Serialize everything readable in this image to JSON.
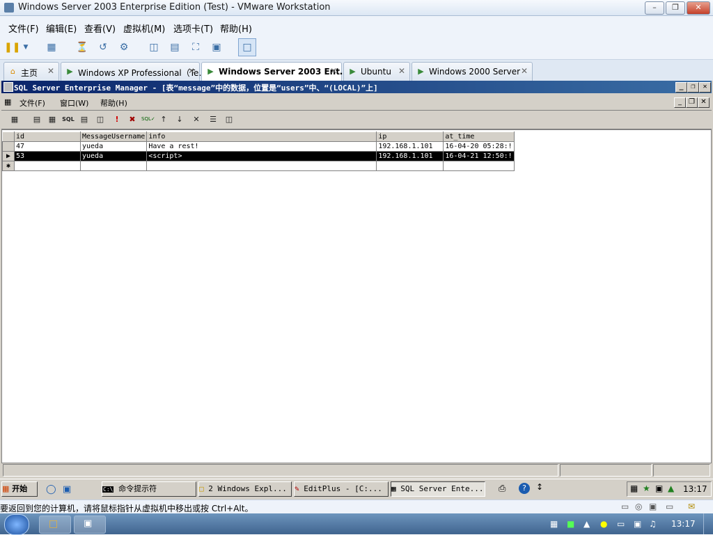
{
  "vmware": {
    "window_title": "Windows Server 2003 Enterprise Edition (Test) - VMware Workstation",
    "menu": [
      "文件(F)",
      "编辑(E)",
      "查看(V)",
      "虚拟机(M)",
      "选项卡(T)",
      "帮助(H)"
    ],
    "tabs": [
      {
        "label": "主页",
        "icon": "home-icon"
      },
      {
        "label": "Windows XP Professional（Te…",
        "icon": "vm-icon"
      },
      {
        "label": "Windows Server 2003 Ent…",
        "icon": "vm-icon"
      },
      {
        "label": "Ubuntu",
        "icon": "vm-icon"
      },
      {
        "label": "Windows 2000 Server",
        "icon": "vm-icon"
      }
    ],
    "hint": "要返回到您的计算机，请将鼠标指针从虚拟机中移出或按 Ctrl+Alt。"
  },
  "sql": {
    "window_title": "SQL Server Enterprise Manager - [表“message”中的数据，位置是“users”中、“(LOCAL)”上]",
    "menu": [
      "文件(F)",
      "窗口(W)",
      "帮助(H)"
    ],
    "grid": {
      "columns": [
        "id",
        "MessageUsername",
        "info",
        "ip",
        "at_time"
      ],
      "rows": [
        [
          "47",
          "yueda",
          "Have a rest!",
          "192.168.1.101",
          "16-04-20 05:28:!"
        ],
        [
          "53",
          "yueda",
          "<script>",
          "192.168.1.101",
          "16-04-21 12:50:!"
        ]
      ],
      "selected_row": 1
    }
  },
  "guest_taskbar": {
    "start": "开始",
    "buttons": [
      "命令提示符",
      "2 Windows Expl...",
      "EditPlus - [C:...",
      "SQL Server Ente..."
    ],
    "clock": "13:17"
  },
  "host_taskbar": {
    "clock": "13:17"
  }
}
